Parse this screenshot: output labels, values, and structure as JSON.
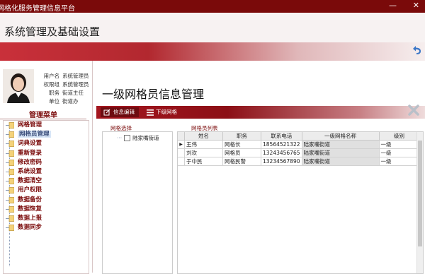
{
  "window": {
    "title": "网格化服务管理信息平台",
    "minimize": "—",
    "close": "✕"
  },
  "header": {
    "system_title": "系统管理及基础设置"
  },
  "user": {
    "rows": [
      {
        "k": "用户名",
        "v": "系统管理员"
      },
      {
        "k": "权限组",
        "v": "系统管理员"
      },
      {
        "k": "职务",
        "v": "街道主任"
      },
      {
        "k": "单位",
        "v": "街道办"
      }
    ]
  },
  "menu": {
    "title": "管理菜单",
    "items": [
      "网格管理",
      "网格员管理",
      "词典设置",
      "重新登录",
      "修改密码",
      "系统设置",
      "数据清空",
      "用户权限",
      "数据备份",
      "数据恢复",
      "数据上报",
      "数据同步"
    ],
    "selected_index": 1
  },
  "main": {
    "page_title": "一级网格员信息管理",
    "tabs": [
      "信息编辑",
      "下级网格"
    ],
    "grid_select_label": "网格选择",
    "grid_list_label": "网格员列表",
    "tree_root": "陆家嘴街道",
    "table": {
      "headers": [
        "姓名",
        "职务",
        "联系电话",
        "一级网格名称",
        "级别"
      ],
      "rows": [
        [
          "王伟",
          "网格长",
          "18564521322",
          "陆家嘴街道",
          "一级"
        ],
        [
          "刘欢",
          "网格员",
          "13243456765",
          "陆家嘴街道",
          "一级"
        ],
        [
          "于中民",
          "网格民警",
          "13234567890",
          "陆家嘴街道",
          "一级"
        ]
      ]
    }
  },
  "colors": {
    "brand_red": "#7a0a0a",
    "accent_blue": "#3c77c7"
  }
}
